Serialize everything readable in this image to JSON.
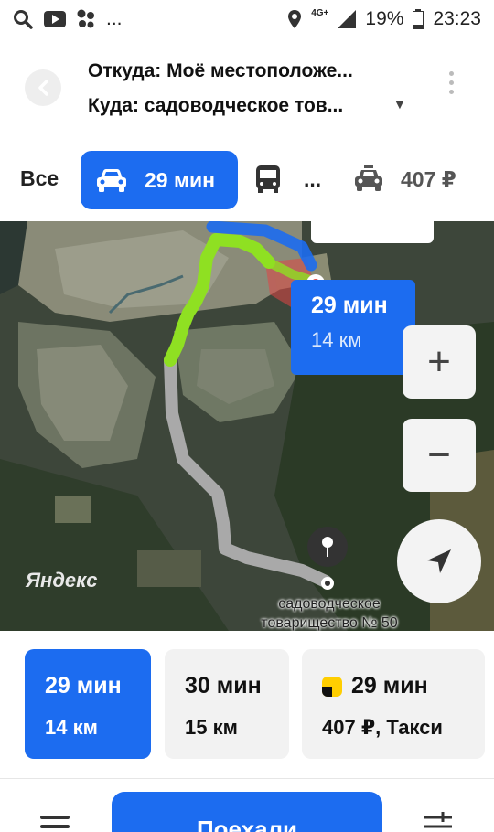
{
  "status_bar": {
    "network": "4G+",
    "battery": "19%",
    "time": "23:23",
    "overflow": "..."
  },
  "route": {
    "from": "Откуда: Моё местоположе...",
    "to": "Куда: садоводческое тов..."
  },
  "tabs": {
    "all": "Все",
    "car": "29 мин",
    "bus": "...",
    "taxi": "407 ₽"
  },
  "map": {
    "bubble_time": "29 мин",
    "bubble_distance": "14 км",
    "zoom_in": "+",
    "zoom_out": "−",
    "logo": "Яндекс",
    "destination_label_line1": "садоводческое",
    "destination_label_line2": "товарищество № 50"
  },
  "cards": [
    {
      "time": "29 мин",
      "detail": "14 км"
    },
    {
      "time": "30 мин",
      "detail": "15 км"
    },
    {
      "time": "29 мин",
      "detail": "407 ₽, Такси"
    }
  ],
  "bottom": {
    "go": "Поехали"
  },
  "colors": {
    "accent": "#1c6cf0",
    "route_green": "#8fe022",
    "route_gray": "#a9a9a9",
    "traffic_red": "#e04545"
  }
}
